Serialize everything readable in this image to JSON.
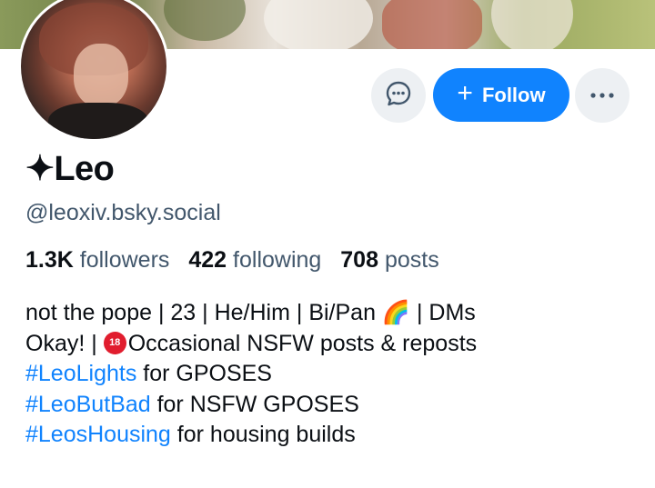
{
  "profile": {
    "display_name": "✦Leo",
    "handle": "@leoxiv.bsky.social",
    "followers_count": "1.3K",
    "followers_label": "followers",
    "following_count": "422",
    "following_label": "following",
    "posts_count": "708",
    "posts_label": "posts"
  },
  "actions": {
    "follow_label": "Follow",
    "follow_icon": "+",
    "message_icon": "message-icon",
    "more_icon": "more-icon"
  },
  "bio": {
    "line1": "not the pope | 23 | He/Him |  Bi/Pan 🌈 | DMs",
    "line2_a": "Okay! | ",
    "line2_emoji": "18",
    "line2_b": "Occasional NSFW posts & reposts",
    "line3_tag": "#LeoLights",
    "line3_text": " for GPOSES",
    "line4_tag": "#LeoButBad",
    "line4_text": " for NSFW GPOSES",
    "line5_tag": "#LeosHousing",
    "line5_text": " for housing builds"
  },
  "colors": {
    "accent": "#1083fe",
    "secondary_text": "#42576c",
    "button_bg": "#edf0f3"
  }
}
